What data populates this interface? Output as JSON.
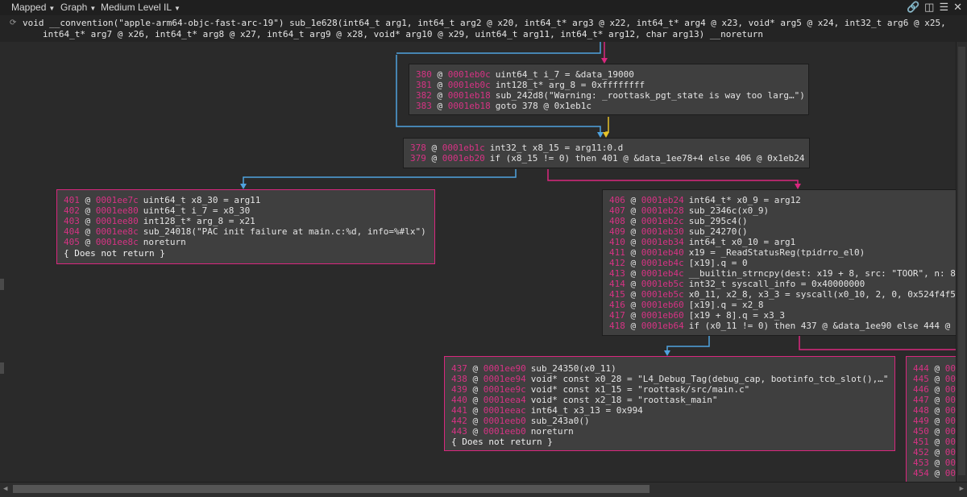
{
  "topbar": {
    "view_mode": "Mapped",
    "graph": "Graph",
    "il": "Medium Level IL"
  },
  "signature": {
    "line1": "void __convention(\"apple-arm64-objc-fast-arc-19\") sub_1e628(int64_t arg1, int64_t arg2 @ x20, int64_t* arg3 @ x22, int64_t* arg4 @ x23, void* arg5 @ x24, int32_t arg6 @ x25,",
    "line2": "int64_t* arg7 @ x26, int64_t* arg8 @ x27, int64_t arg9 @ x28, void* arg10 @ x29, uint64_t arg11, int64_t* arg12, char arg13) __noreturn"
  },
  "blocks": {
    "b380": [
      {
        "n": "380",
        "a": "0001eb0c",
        "t": "uint64_t i_7 = &data_19000"
      },
      {
        "n": "381",
        "a": "0001eb0c",
        "t": "int128_t* arg_8 = 0xffffffff"
      },
      {
        "n": "382",
        "a": "0001eb18",
        "t": "sub_242d8(\"Warning: _roottask_pgt_state is way too larg…\")"
      },
      {
        "n": "383",
        "a": "0001eb18",
        "t": "goto 378 @ 0x1eb1c"
      }
    ],
    "b378": [
      {
        "n": "378",
        "a": "0001eb1c",
        "t": "int32_t x8_15 = arg11:0.d"
      },
      {
        "n": "379",
        "a": "0001eb20",
        "t": "if (x8_15 != 0) then 401 @ &data_1ee78+4 else 406 @ 0x1eb24"
      }
    ],
    "b401": [
      {
        "n": "401",
        "a": "0001ee7c",
        "t": "uint64_t x8_30 = arg11"
      },
      {
        "n": "402",
        "a": "0001ee80",
        "t": "uint64_t i_7 = x8_30"
      },
      {
        "n": "403",
        "a": "0001ee80",
        "t": "int128_t* arg_8 = x21"
      },
      {
        "n": "404",
        "a": "0001ee8c",
        "t": "sub_24018(\"PAC init failure at main.c:%d, info=%#lx\")"
      },
      {
        "n": "405",
        "a": "0001ee8c",
        "t": "noreturn"
      }
    ],
    "b401_footer": "{ Does not return }",
    "b406": [
      {
        "n": "406",
        "a": "0001eb24",
        "t": "int64_t* x0_9 = arg12"
      },
      {
        "n": "407",
        "a": "0001eb28",
        "t": "sub_2346c(x0_9)"
      },
      {
        "n": "408",
        "a": "0001eb2c",
        "t": "sub_295c4()"
      },
      {
        "n": "409",
        "a": "0001eb30",
        "t": "sub_24270()"
      },
      {
        "n": "410",
        "a": "0001eb34",
        "t": "int64_t x0_10 = arg1"
      },
      {
        "n": "411",
        "a": "0001eb40",
        "t": "x19 = _ReadStatusReg(tpidrro_el0)"
      },
      {
        "n": "412",
        "a": "0001eb4c",
        "t": "[x19].q = 0"
      },
      {
        "n": "413",
        "a": "0001eb4c",
        "t": "__builtin_strncpy(dest: x19 + 8, src: \"TOOR\", n: 8"
      },
      {
        "n": "414",
        "a": "0001eb5c",
        "t": "int32_t syscall_info = 0x40000000"
      },
      {
        "n": "415",
        "a": "0001eb5c",
        "t": "x0_11, x2_8, x3_3 = syscall(x0_10, 2, 0, 0x524f4f5"
      },
      {
        "n": "416",
        "a": "0001eb60",
        "t": "[x19].q = x2_8"
      },
      {
        "n": "417",
        "a": "0001eb60",
        "t": "[x19 + 8].q = x3_3"
      },
      {
        "n": "418",
        "a": "0001eb64",
        "t": "if (x0_11 != 0) then 437 @ &data_1ee90 else 444 @"
      }
    ],
    "b437": [
      {
        "n": "437",
        "a": "0001ee90",
        "t": "sub_24350(x0_11)"
      },
      {
        "n": "438",
        "a": "0001ee94",
        "t": "void* const x0_28 = \"L4_Debug_Tag(debug_cap, bootinfo_tcb_slot(),…\""
      },
      {
        "n": "439",
        "a": "0001ee9c",
        "t": "void* const x1_15 = \"roottask/src/main.c\""
      },
      {
        "n": "440",
        "a": "0001eea4",
        "t": "void* const x2_18 = \"roottask_main\""
      },
      {
        "n": "441",
        "a": "0001eeac",
        "t": "int64_t x3_13 = 0x994"
      },
      {
        "n": "442",
        "a": "0001eeb0",
        "t": "sub_243a0()"
      },
      {
        "n": "443",
        "a": "0001eeb0",
        "t": "noreturn"
      }
    ],
    "b437_footer": "{ Does not return }",
    "b444": [
      {
        "n": "444",
        "a": "00"
      },
      {
        "n": "445",
        "a": "00"
      },
      {
        "n": "446",
        "a": "00"
      },
      {
        "n": "447",
        "a": "00"
      },
      {
        "n": "448",
        "a": "00"
      },
      {
        "n": "449",
        "a": "00"
      },
      {
        "n": "450",
        "a": "00"
      },
      {
        "n": "451",
        "a": "00"
      },
      {
        "n": "452",
        "a": "00"
      },
      {
        "n": "453",
        "a": "00"
      },
      {
        "n": "454",
        "a": "00"
      }
    ]
  },
  "colors": {
    "accent_pink": "#d9277e",
    "edge_blue": "#4fa3e0",
    "edge_yellow": "#e6c229",
    "function_blue": "#5aa9ff"
  }
}
